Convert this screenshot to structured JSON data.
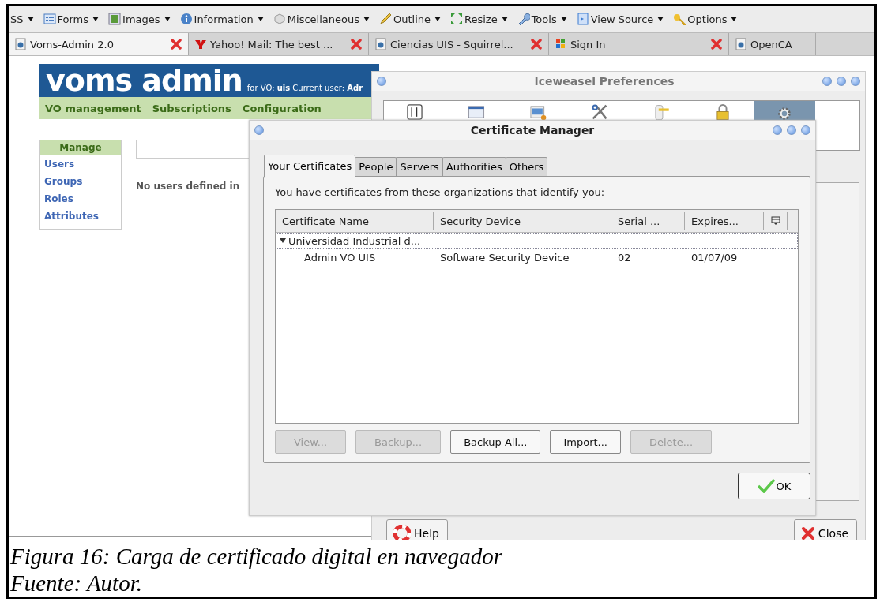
{
  "toolbar": {
    "items": [
      {
        "label": "SS"
      },
      {
        "label": "Forms"
      },
      {
        "label": "Images"
      },
      {
        "label": "Information"
      },
      {
        "label": "Miscellaneous"
      },
      {
        "label": "Outline"
      },
      {
        "label": "Resize"
      },
      {
        "label": "Tools"
      },
      {
        "label": "View Source"
      },
      {
        "label": "Options"
      }
    ]
  },
  "tabs": [
    {
      "label": "Voms-Admin 2.0",
      "selected": true,
      "closable": true
    },
    {
      "label": "Yahoo! Mail: The best ...",
      "selected": false,
      "closable": true
    },
    {
      "label": "Ciencias UIS - Squirrel...",
      "selected": false,
      "closable": true
    },
    {
      "label": "Sign In",
      "selected": false,
      "closable": true
    },
    {
      "label": "OpenCA",
      "selected": false,
      "closable": false
    }
  ],
  "voms": {
    "logo": "voms admin",
    "vo_label": "for VO:",
    "vo": "uis",
    "user_label": "Current user:",
    "user": "Adr",
    "nav": [
      "VO management",
      "Subscriptions",
      "Configuration"
    ],
    "manage": {
      "title": "Manage",
      "links": [
        "Users",
        "Groups",
        "Roles",
        "Attributes"
      ]
    },
    "message": "No users defined in"
  },
  "preferences": {
    "title": "Iceweasel Preferences",
    "panes": [
      {
        "selected": false
      },
      {
        "selected": false
      },
      {
        "selected": false
      },
      {
        "selected": false
      },
      {
        "selected": false
      },
      {
        "selected": false
      },
      {
        "selected": true
      }
    ],
    "buttons": [
      "Help",
      "Close"
    ]
  },
  "certificate_manager": {
    "title": "Certificate Manager",
    "tabs": [
      {
        "label": "Your Certificates",
        "selected": true
      },
      {
        "label": "People",
        "selected": false
      },
      {
        "label": "Servers",
        "selected": false
      },
      {
        "label": "Authorities",
        "selected": false
      },
      {
        "label": "Others",
        "selected": false
      }
    ],
    "intro": "You have certificates from these organizations that identify you:",
    "columns": [
      "Certificate Name",
      "Security Device",
      "Serial ...",
      "Expires..."
    ],
    "groups": [
      {
        "name": "Universidad Industrial d...",
        "expanded": true,
        "children": [
          {
            "cells": [
              "Admin VO UIS",
              "Software Security Device",
              "02",
              "01/07/09"
            ]
          }
        ]
      }
    ],
    "buttons": [
      {
        "label": "View...",
        "disabled": true
      },
      {
        "label": "Backup...",
        "disabled": true
      },
      {
        "label": "Backup All...",
        "disabled": false
      },
      {
        "label": "Import...",
        "disabled": false
      },
      {
        "label": "Delete...",
        "disabled": true
      }
    ],
    "ok": "OK"
  },
  "caption": {
    "figure": "Figura 16: Carga de certificado digital en navegador",
    "source": "Fuente: Autor."
  }
}
